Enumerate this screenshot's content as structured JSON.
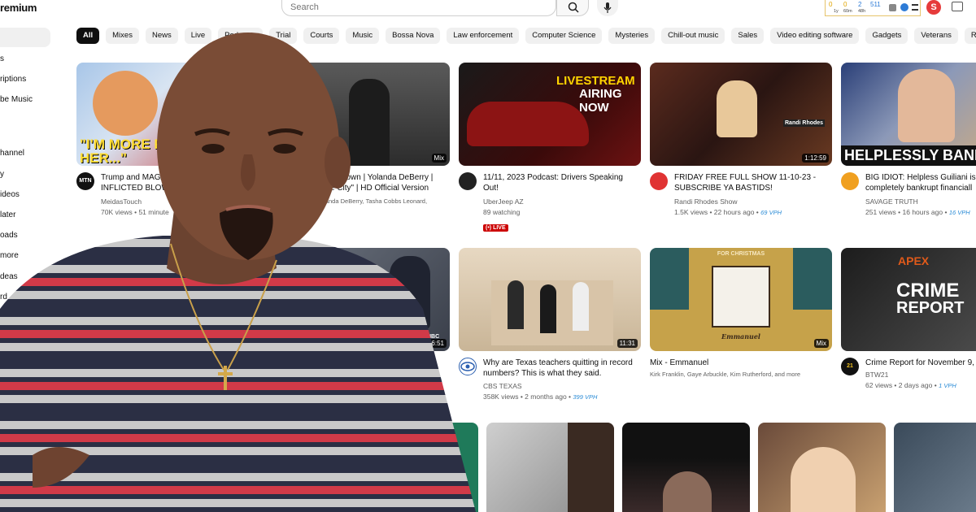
{
  "masthead": {
    "logo_text": "remium",
    "search_placeholder": "Search"
  },
  "extension": {
    "stats": [
      "0",
      "0",
      "2",
      "511"
    ],
    "subs": [
      "1y",
      "60m",
      "48h",
      ""
    ],
    "avatar_letter": "S"
  },
  "sidebar": {
    "items": [
      "s",
      "riptions",
      "be Music",
      "hannel",
      "y",
      "ideos",
      "later",
      "oads",
      "more",
      "deas",
      "rd"
    ]
  },
  "chips": [
    "All",
    "Mixes",
    "News",
    "Live",
    "Podcasts",
    "Trial",
    "Courts",
    "Music",
    "Bossa Nova",
    "Law enforcement",
    "Computer Science",
    "Mysteries",
    "Chill-out music",
    "Sales",
    "Video editing software",
    "Gadgets",
    "Veterans",
    "Recently u"
  ],
  "videos": [
    {
      "title": "Trump and MAGA",
      "title2": "INFLICTED BLOW,",
      "channel": "MeidasTouch",
      "meta": "70K views • 51 minute",
      "avatar": "MTN",
      "thumb_text": "\"I'M MORE POP THAN HER...\""
    },
    {
      "title": "A Crown | Yolanda DeBerry |",
      "title2": "e City\" | HD Official Version",
      "channel": "olanda DeBerry, Tasha Cobbs Leonard,",
      "badge": "Mix"
    },
    {
      "title": "11/11, 2023 Podcast: Drivers Speaking Out!",
      "channel": "UberJeep AZ",
      "meta": "89 watching",
      "live": "LIVE",
      "thumb_text1": "LIVESTREAM",
      "thumb_text2": "AIRING NOW"
    },
    {
      "title": "FRIDAY FREE FULL SHOW 11-10-23 - SUBSCRIBE YA BASTIDS!",
      "channel": "Randi Rhodes Show",
      "meta": "1.5K views • 22 hours ago •",
      "vph": "69 VPH",
      "duration": "1:12:59",
      "thumb_text": "Randi Rhodes"
    },
    {
      "title": "BIG IDIOT: Helpless Guiliani is",
      "title2": "completely bankrupt financiall",
      "channel": "SAVAGE TRUTH",
      "meta": "251 views • 16 hours ago •",
      "vph": "16 VPH",
      "thumb_text": "HELPLESSLY BANK"
    },
    {
      "duration": "6:51",
      "thumb_text": "NBC"
    },
    {
      "title": "Why are Texas teachers quitting in record numbers? This is what they said.",
      "channel": "CBS TEXAS",
      "meta": "358K views • 2 months ago •",
      "vph": "399 VPH",
      "duration": "11:31"
    },
    {
      "title": "Mix - Emmanuel",
      "channel": "Kirk Franklin, Gaye Arbuckle, Kim Rutherford, and more",
      "badge": "Mix",
      "thumb_text": "Emmanuel",
      "thumb_header": "FOR CHRISTMAS"
    },
    {
      "title": "Crime Report for November 9,",
      "channel": "BTW21",
      "meta": "62 views • 2 days ago •",
      "vph": "1 VPH",
      "thumb_text1": "APEX",
      "thumb_text2": "CRIME",
      "thumb_text3": "REPORT",
      "avatar": "21"
    }
  ],
  "colors": {
    "accent_red": "#cc0000",
    "vph_blue": "#2a8bd6",
    "chip_bg": "#f0f0f0"
  }
}
